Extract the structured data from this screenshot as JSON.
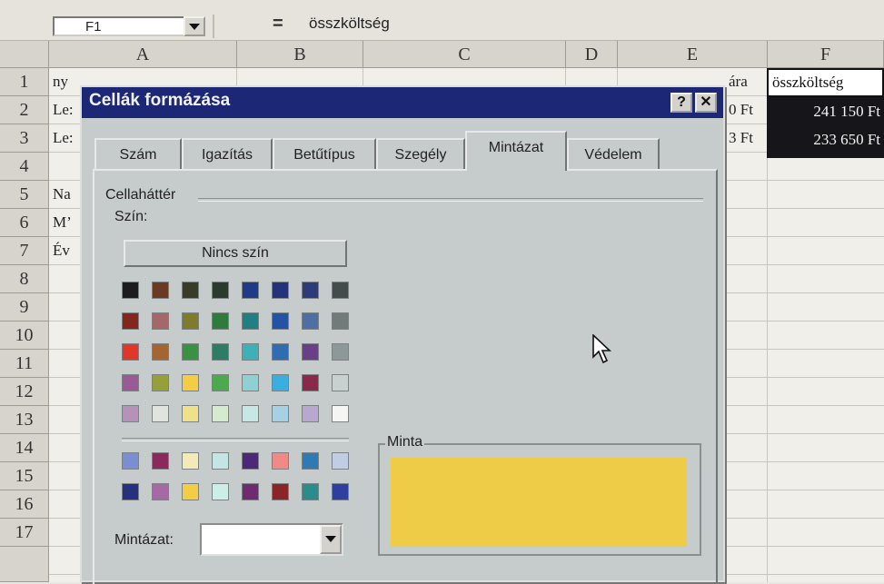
{
  "formula_bar": {
    "name_box": "F1",
    "equals": "=",
    "content": "összköltség"
  },
  "columns": [
    "A",
    "B",
    "C",
    "D",
    "E",
    "F"
  ],
  "rows": [
    "1",
    "2",
    "3",
    "4",
    "5",
    "6",
    "7",
    "8",
    "9",
    "10",
    "11",
    "12",
    "13",
    "14",
    "15",
    "16",
    "17"
  ],
  "cells": {
    "a1": "ny",
    "a2": "Le:",
    "a3": "Le:",
    "a5": "Na",
    "a6": "M’",
    "a7": "Év",
    "e1": "ára",
    "e2": "0 Ft",
    "e3": "3 Ft",
    "f1": "összköltség",
    "f2": "241 150 Ft",
    "f3": "233 650 Ft"
  },
  "dialog": {
    "title": "Cellák formázása",
    "help_button": "?",
    "close_button": "✕",
    "tabs": [
      {
        "label": "Szám"
      },
      {
        "label": "Igazítás"
      },
      {
        "label": "Betűtípus"
      },
      {
        "label": "Szegély"
      },
      {
        "label": "Mintázat"
      },
      {
        "label": "Védelem"
      }
    ],
    "active_tab": "Mintázat",
    "group_label": "Cellaháttér",
    "color_label": "Szín:",
    "no_color_button": "Nincs szín",
    "palette_rows": [
      [
        "#1b1c1c",
        "#6a3a23",
        "#383d26",
        "#2a3a2c",
        "#1f3a86",
        "#23327a",
        "#2e3b7a",
        "#454d4c"
      ],
      [
        "#84261d",
        "#a4686b",
        "#7e7b2d",
        "#2f7b3c",
        "#1f7f83",
        "#2453a4",
        "#4d6fa2",
        "#737b7a"
      ],
      [
        "#e0372a",
        "#a36532",
        "#3a9142",
        "#2f7c66",
        "#3eb1b8",
        "#2f6db0",
        "#6a3f87",
        "#8d9999"
      ],
      [
        "#9a5a93",
        "#96a03a",
        "#f5cd45",
        "#4ea84e",
        "#8fd1d3",
        "#3aaedf",
        "#8a2a4a",
        "#c8d0d0"
      ],
      [
        "#b691b8",
        "#dfe4de",
        "#f1e08a",
        "#d6ead0",
        "#c6e7e3",
        "#a8d0e3",
        "#b8a8cf",
        "#f5f6f4"
      ]
    ],
    "palette_rows_2": [
      [
        "#7a8fd1",
        "#8b2a5a",
        "#f4eab8",
        "#c3e6e4",
        "#4d2878",
        "#f08a86",
        "#2f7ab3",
        "#c0cde4"
      ],
      [
        "#26307e",
        "#a569a6",
        "#f3ce45",
        "#cdeee8",
        "#6e2b71",
        "#8b2426",
        "#2a8d8b",
        "#2d40a0"
      ]
    ],
    "selected_color": "#f3ce45",
    "pattern_label": "Mintázat:",
    "preview_label": "Minta",
    "preview_color": "#efcc47"
  }
}
